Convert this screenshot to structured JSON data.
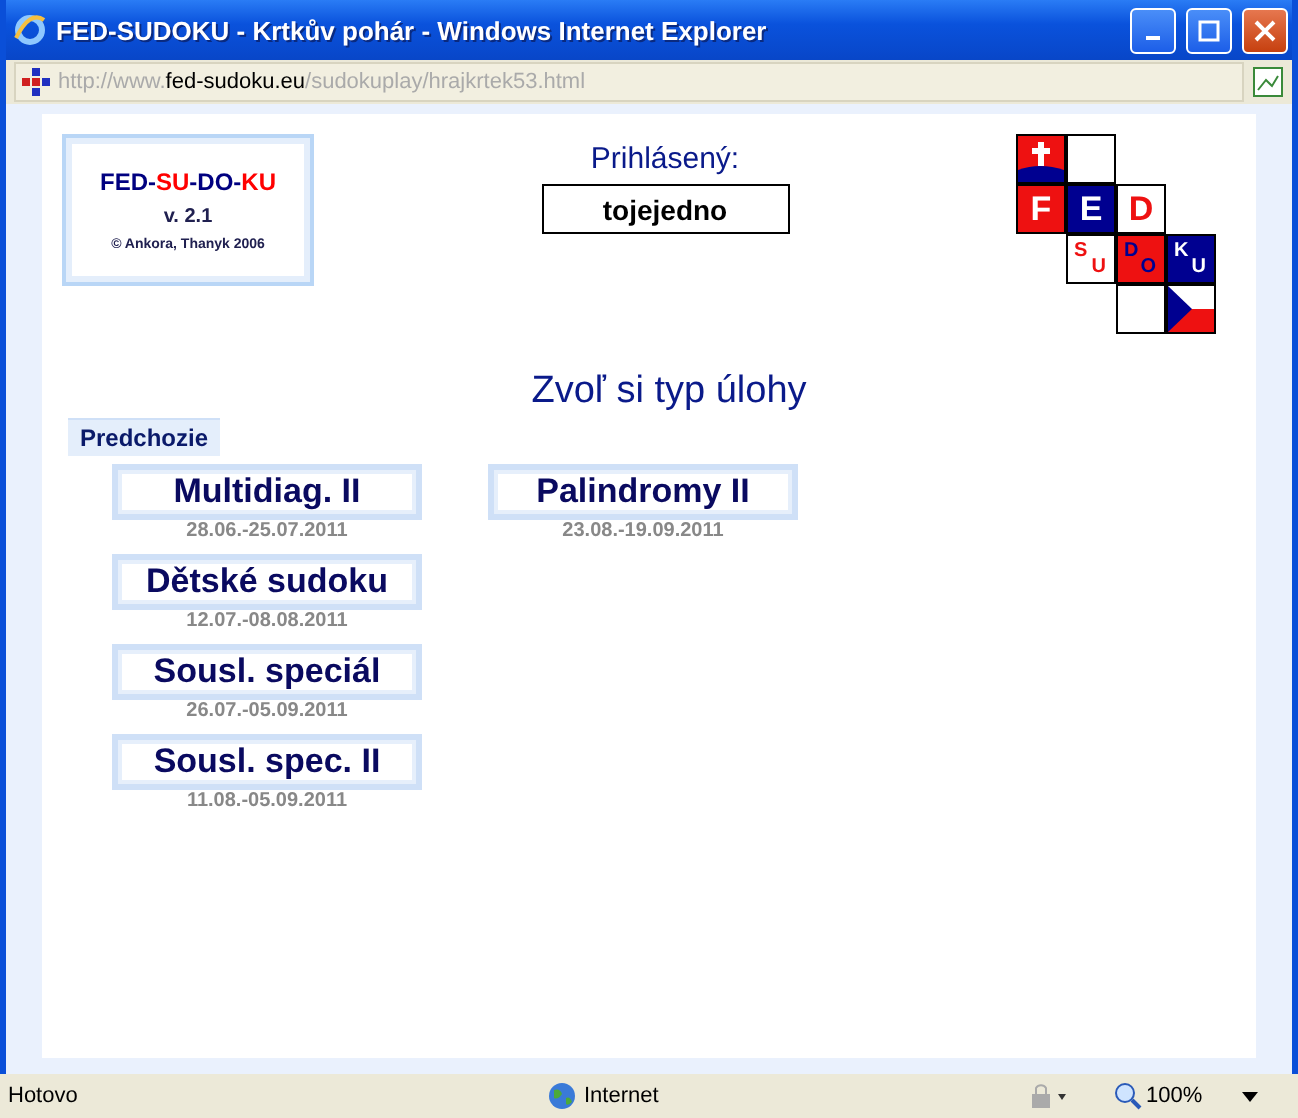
{
  "window": {
    "title": "FED-SUDOKU - Krtkův pohár - Windows Internet Explorer"
  },
  "address": {
    "prefix": "http://www.",
    "domain": "fed-sudoku.eu",
    "path": "/sudokuplay/hrajkrtek53.html"
  },
  "logo": {
    "parts": [
      {
        "text": "FED-",
        "color": "#000080"
      },
      {
        "text": "SU",
        "color": "#ff0000"
      },
      {
        "text": "-DO-",
        "color": "#000080"
      },
      {
        "text": "KU",
        "color": "#ff0000"
      }
    ],
    "version": "v. 2.1",
    "credit": "© Ankora, Thanyk 2006"
  },
  "login": {
    "label": "Prihlásený:",
    "user": "tojejedno"
  },
  "emblem": {
    "letters": [
      "F",
      "E",
      "D",
      "S",
      "U",
      "D",
      "O",
      "K",
      "U"
    ]
  },
  "heading": "Zvoľ si typ úlohy",
  "section_tab": "Predchozie",
  "columns": [
    [
      {
        "title": "Multidiag. II",
        "dates": "28.06.-25.07.2011"
      },
      {
        "title": "Dětské sudoku",
        "dates": "12.07.-08.08.2011"
      },
      {
        "title": "Sousl. speciál",
        "dates": "26.07.-05.09.2011"
      },
      {
        "title": "Sousl. spec. II",
        "dates": "11.08.-05.09.2011"
      }
    ],
    [
      {
        "title": "Palindromy II",
        "dates": "23.08.-19.09.2011"
      }
    ]
  ],
  "status_bar": {
    "text": "Hotovo",
    "zone": "Internet",
    "zoom": "100%"
  }
}
